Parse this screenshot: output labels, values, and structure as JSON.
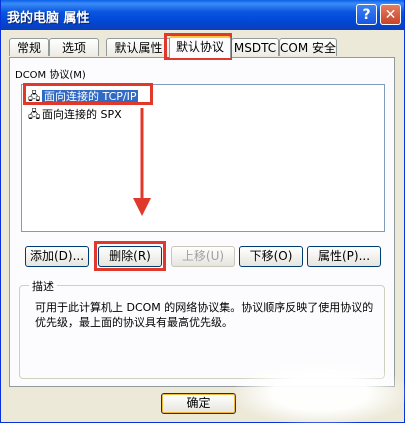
{
  "window": {
    "title": "我的电脑 属性"
  },
  "titlebar": {
    "help_glyph": "?",
    "close_glyph": "✕"
  },
  "tabs": [
    {
      "label": "常规"
    },
    {
      "label": "选项"
    },
    {
      "label": "默认属性"
    },
    {
      "label": "默认协议",
      "active": true
    },
    {
      "label": "MSDTC"
    },
    {
      "label": "COM 安全"
    }
  ],
  "protocols": {
    "label": "DCOM 协议(M)",
    "items": [
      {
        "icon": "network-icon",
        "label": "面向连接的 TCP/IP",
        "selected": true
      },
      {
        "icon": "network-icon",
        "label": "面向连接的 SPX",
        "selected": false
      }
    ]
  },
  "buttons": {
    "add": "添加(D)...",
    "remove": "删除(R)",
    "move_up": "上移(U)",
    "move_down": "下移(O)",
    "properties": "属性(P)..."
  },
  "description": {
    "legend": "描述",
    "text": "可用于此计算机上 DCOM 的网络协议集。协议顺序反映了使用协议的优先级，最上面的协议具有最高优先级。"
  },
  "footer": {
    "ok": "确定"
  },
  "colors": {
    "annotation": "#e0392b",
    "selection": "#316ac5",
    "titlebar": "#0148d6"
  }
}
